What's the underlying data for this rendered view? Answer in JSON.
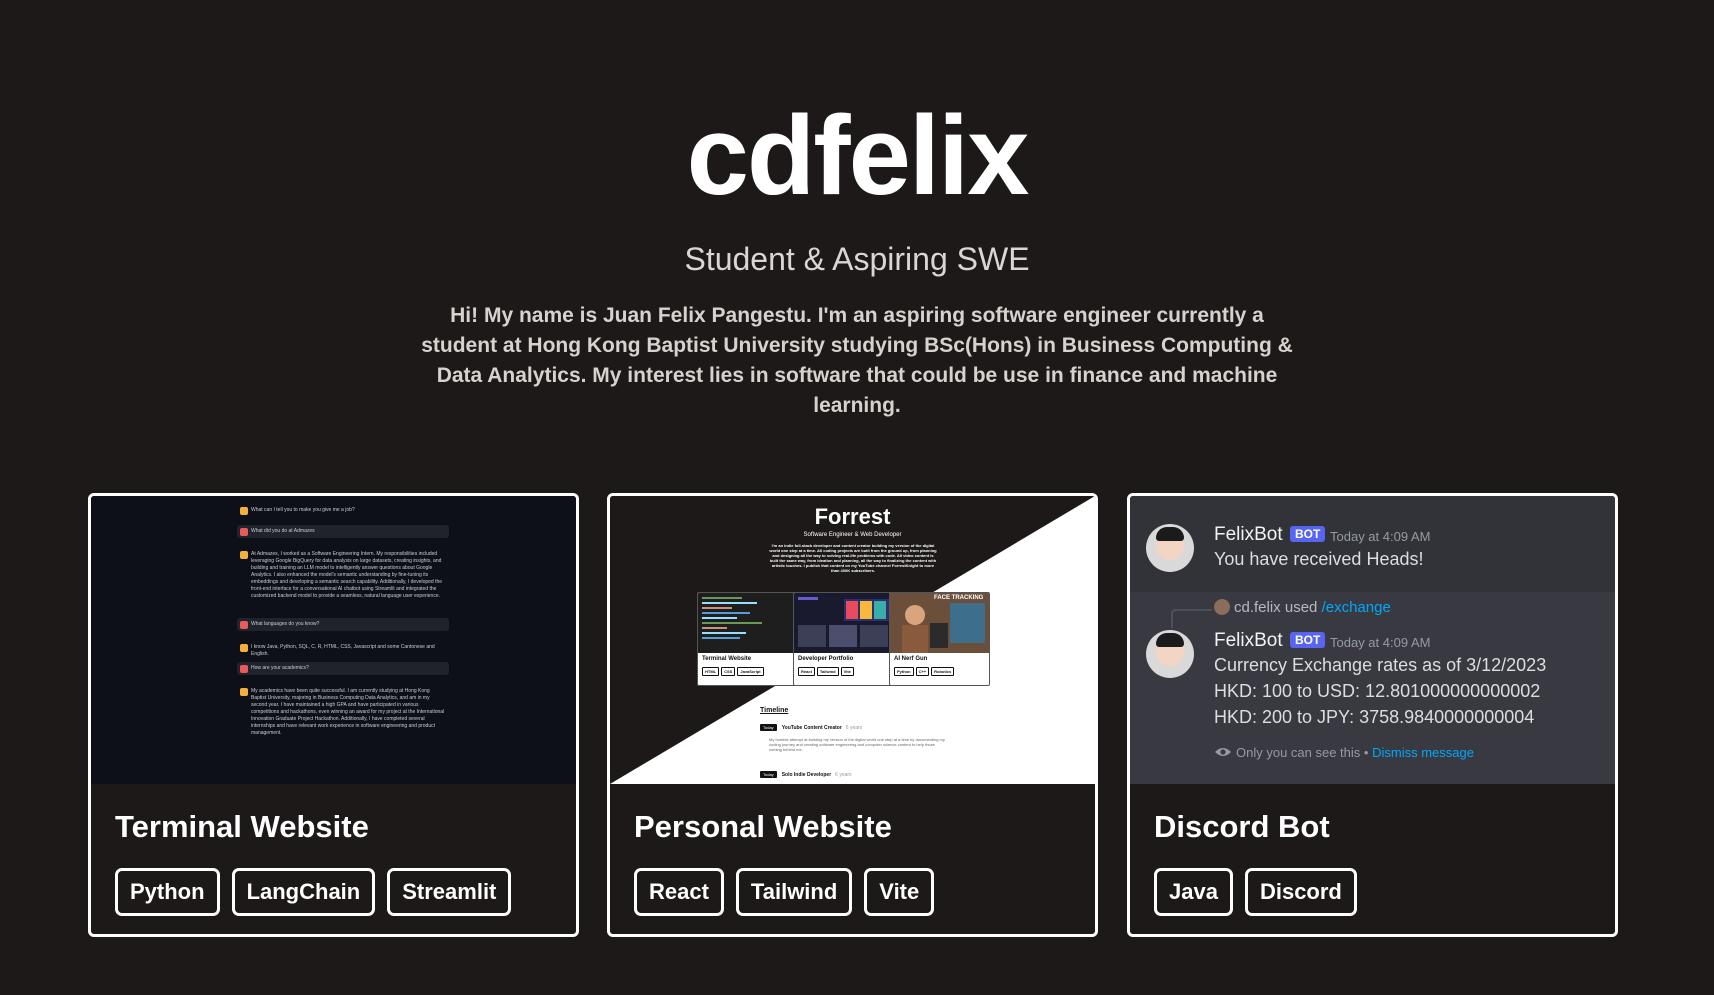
{
  "header": {
    "title": "cdfelix",
    "subtitle": "Student & Aspiring SWE",
    "bio": "Hi! My name is Juan Felix Pangestu. I'm an aspiring software engineer currently a student at Hong Kong Baptist University studying BSc(Hons) in Business Computing & Data Analytics. My interest lies in software that could be use in finance and machine learning."
  },
  "projects": [
    {
      "title": "Terminal Website",
      "tags": [
        "Python",
        "LangChain",
        "Streamlit"
      ],
      "preview": {
        "messages": [
          {
            "role": "bot",
            "text": "What can I tell you to make you give me a job?"
          },
          {
            "role": "user",
            "text": "What did you do at Admazes"
          },
          {
            "role": "bot",
            "text": "At Admazes, I worked as a Software Engineering Intern. My responsibilities included leveraging Google BigQuery for data analysis on large datasets, creating insights, and building and training an LLM model to intelligently answer questions about Google Analytics. I also enhanced the model's semantic understanding by fine-tuning its embeddings and developing a semantic search capability. Additionally, I developed the front-end interface for a conversational AI chatbot using Streamlit and integrated the customized backend model to provide a seamless, natural language user experience."
          },
          {
            "role": "user",
            "text": "What languages do you know?"
          },
          {
            "role": "bot",
            "text": "I know Java, Python, SQL, C, R, HTML, CSS, Javascript and some Cantonese and English."
          },
          {
            "role": "user",
            "text": "How are your academics?"
          },
          {
            "role": "bot",
            "text": "My academics have been quite successful. I am currently studying at Hong Kong Baptist University, majoring in Business Computing Data Analytics, and am in my second year. I have maintained a high GPA and have participated in various competitions and hackathons, even winning an award for my project at the International Innovation Graduate Project Hackathon. Additionally, I have completed several internships and have relevant work experience in software engineering and product management."
          }
        ]
      }
    },
    {
      "title": "Personal Website",
      "tags": [
        "React",
        "Tailwind",
        "Vite"
      ],
      "preview": {
        "name": "Forrest",
        "role": "Software Engineer & Web Developer",
        "bio": "I'm an indie full-stack developer and content creator building my version of the digital world one step at a time. All coding projects are built from the ground up, from planning and designing all the way to solving real-life problems with code. All video content is built the same way, from ideation and planning, all the way to finalizing the content with artistic touches. I publish that content on my YouTube channel ForrestKnight to more than 400K subscribers.",
        "mini_cards": [
          {
            "title": "Terminal Website",
            "tags": [
              "HTML",
              "CSS",
              "JavaScript"
            ]
          },
          {
            "title": "Developer Portfolio",
            "tags": [
              "React",
              "Tailwind",
              "Vite"
            ]
          },
          {
            "title": "AI Nerf Gun",
            "tags": [
              "Python",
              "C++",
              "Robotics"
            ],
            "overlay": "FACE TRACKING"
          }
        ],
        "timeline_heading": "Timeline",
        "timeline": [
          {
            "badge": "Today",
            "title": "YouTube Content Creator",
            "duration": "6 years",
            "desc": "My humble attempt at building my version of the digital world one step at a time by documenting my coding journey and creating software engineering and computer science content to help those coming behind me."
          },
          {
            "badge": "Today",
            "title": "Solo Indie Developer",
            "duration": "6 years"
          }
        ]
      }
    },
    {
      "title": "Discord Bot",
      "tags": [
        "Java",
        "Discord"
      ],
      "preview": {
        "bot_name": "FelixBot",
        "bot_badge": "BOT",
        "timestamp": "Today at 4:09 AM",
        "msg1": "You have received Heads!",
        "reply_user": "cd.felix",
        "reply_used": "used",
        "reply_command": "/exchange",
        "msg2_lines": [
          "Currency Exchange rates as of 3/12/2023",
          "HKD: 100 to USD: 12.801000000000002",
          "HKD: 200 to JPY: 3758.9840000000004"
        ],
        "ephemeral_text": "Only you can see this",
        "ephemeral_sep": "•",
        "dismiss_label": "Dismiss message"
      }
    }
  ],
  "colors": {
    "background": "#1d1918",
    "card_border": "#ffffff",
    "discord_bg": "#313338",
    "discord_blurple": "#5865f2",
    "discord_link": "#00a8fc"
  }
}
